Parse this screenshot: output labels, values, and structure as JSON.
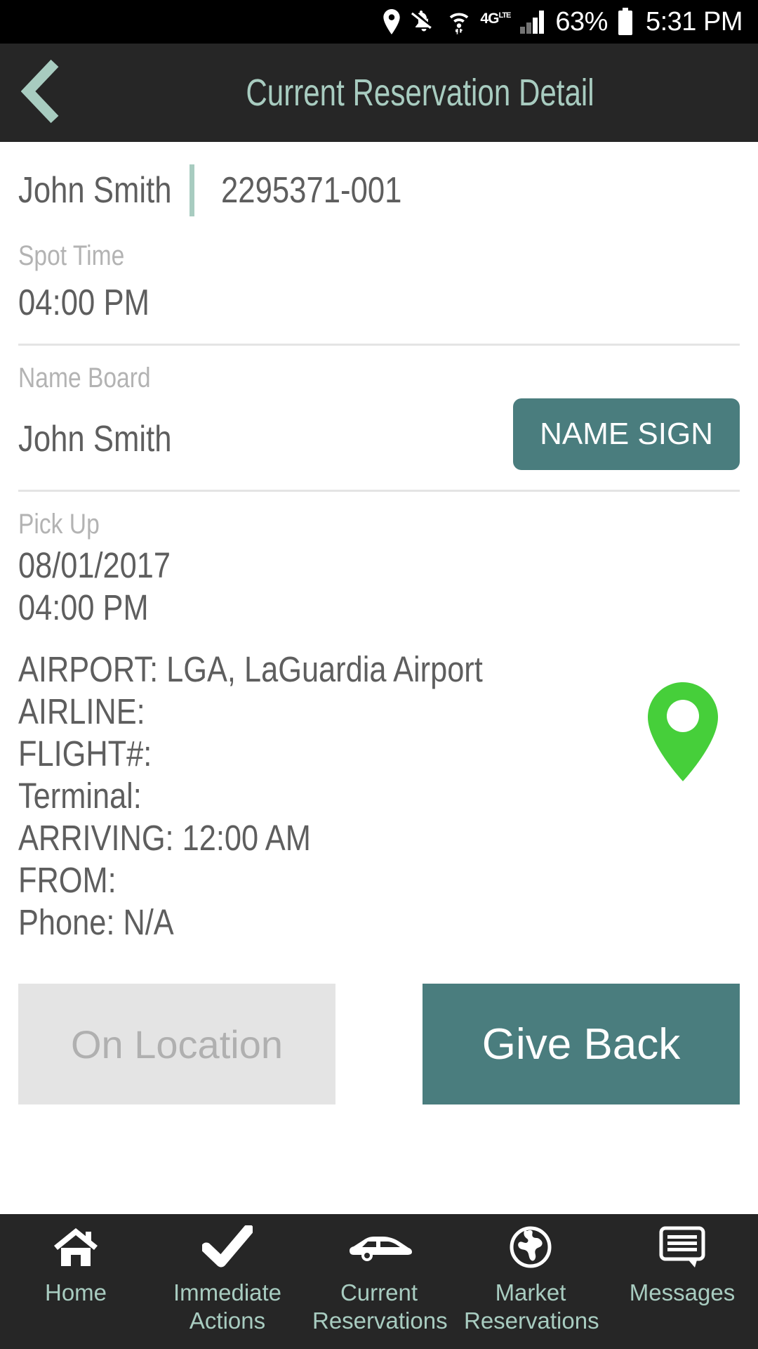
{
  "status_bar": {
    "icons": [
      "location-pin-icon",
      "bell-muted-icon",
      "wifi-icon",
      "network-4g-icon",
      "signal-bars-icon",
      "battery-icon"
    ],
    "network_label": "4G",
    "network_sup": "LTE",
    "battery_percent": "63%",
    "clock": "5:31 PM"
  },
  "header": {
    "back_icon": "chevron-left-icon",
    "title": "Current Reservation Detail"
  },
  "reservation": {
    "passenger_name": "John Smith",
    "confirmation_number": "2295371-001",
    "spot_time": {
      "label": "Spot Time",
      "value": "04:00 PM"
    },
    "name_board": {
      "label": "Name Board",
      "value": "John Smith",
      "button_label": "NAME SIGN"
    },
    "pick_up": {
      "label": "Pick Up",
      "date": "08/01/2017",
      "time": "04:00 PM",
      "details": [
        "AIRPORT: LGA, LaGuardia Airport",
        "AIRLINE:",
        "FLIGHT#:",
        "Terminal:",
        "ARRIVING: 12:00 AM",
        "FROM:",
        "Phone: N/A"
      ],
      "map_pin_icon": "map-pin-icon"
    }
  },
  "actions": {
    "on_location_label": "On Location",
    "give_back_label": "Give Back"
  },
  "bottom_nav": [
    {
      "icon": "home-icon",
      "line1": "Home",
      "line2": ""
    },
    {
      "icon": "check-icon",
      "line1": "Immediate",
      "line2": "Actions"
    },
    {
      "icon": "car-icon",
      "line1": "Current",
      "line2": "Reservations"
    },
    {
      "icon": "globe-icon",
      "line1": "Market",
      "line2": "Reservations"
    },
    {
      "icon": "messages-icon",
      "line1": "Messages",
      "line2": ""
    }
  ],
  "colors": {
    "accent_teal": "#4a7d7e",
    "accent_sage": "#a8ccc0",
    "header_dark": "#262626",
    "pin_green": "#46cf3a",
    "text_gray": "#5e5e5e",
    "label_gray": "#b3b3b3",
    "disabled_bg": "#e4e4e4"
  }
}
